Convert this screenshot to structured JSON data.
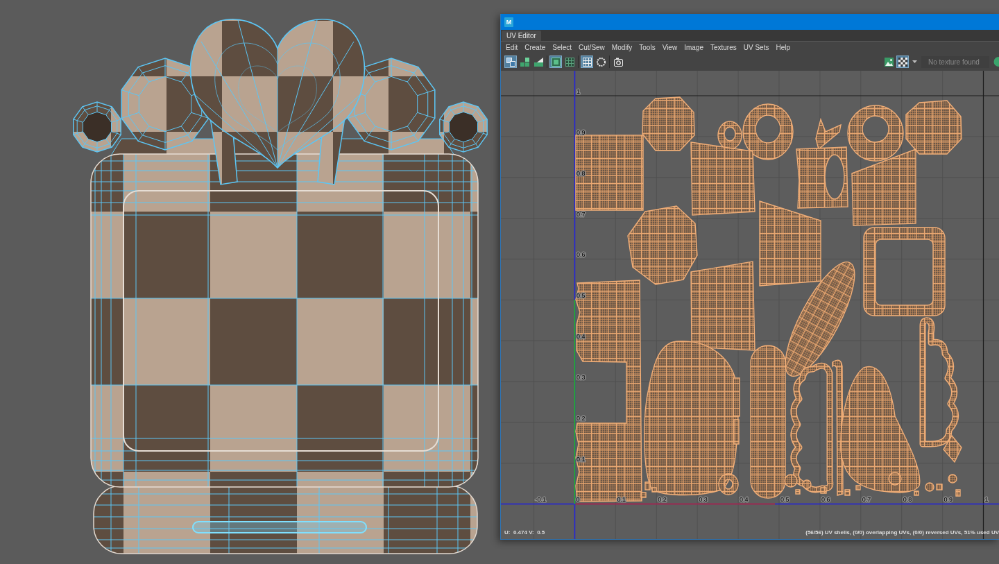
{
  "uv_editor": {
    "app_logo": "M",
    "tabs": [
      {
        "label": "UV Editor",
        "selected": true
      }
    ],
    "menu": [
      "Edit",
      "Create",
      "Select",
      "Cut/Sew",
      "Modify",
      "Tools",
      "View",
      "Image",
      "Textures",
      "UV Sets",
      "Help"
    ],
    "toolbar_groups": [
      {
        "buttons": [
          {
            "kind": "layout",
            "selected": true
          },
          {
            "kind": "stack",
            "selected": false
          },
          {
            "kind": "stack-mixed",
            "selected": false
          }
        ]
      },
      {
        "buttons": [
          {
            "kind": "frame",
            "selected": true
          },
          {
            "kind": "grid-dark",
            "selected": false
          }
        ]
      },
      {
        "buttons": [
          {
            "kind": "grid",
            "selected": true
          },
          {
            "kind": "ring",
            "selected": false
          }
        ]
      },
      {
        "buttons": [
          {
            "kind": "camera",
            "selected": false
          }
        ]
      }
    ],
    "view_tools": [
      {
        "kind": "image",
        "selected": false
      },
      {
        "kind": "checker",
        "selected": true
      }
    ],
    "texture_menu": {
      "value": "No texture found"
    },
    "trailing_tools": [
      {
        "kind": "channels",
        "selected": false
      }
    ],
    "grid": {
      "u_ticks": [
        "-0.1",
        "0",
        "0.1",
        "0.2",
        "0.3",
        "0.4",
        "0.5",
        "0.6",
        "0.7",
        "0.8",
        "0.9",
        "1"
      ],
      "v_ticks": [
        "1",
        "0.9",
        "0.8",
        "0.7",
        "0.6",
        "0.5",
        "0.4",
        "0.3",
        "0.2",
        "0.1"
      ]
    },
    "status": {
      "coordinates": "U:  0.474 V:  0.5",
      "summary": "(56/56) UV shells, (0/0) overlapping UVs, (0/0) reversed UVs, 51% used UV"
    }
  }
}
